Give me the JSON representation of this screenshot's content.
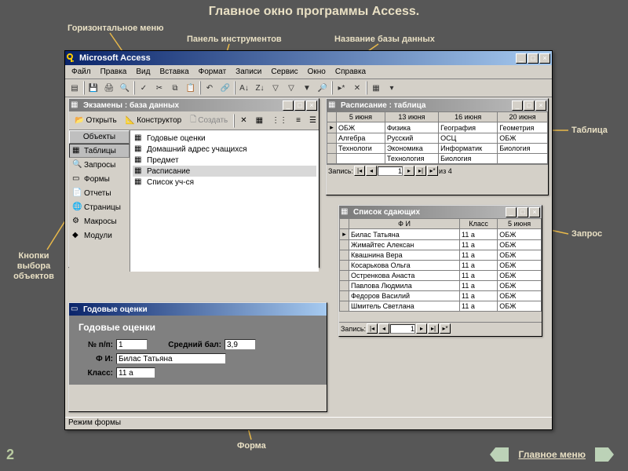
{
  "slide": {
    "title": "Главное окно программы Access.",
    "page_number": "2",
    "main_menu_link": "Главное меню"
  },
  "annotations": {
    "horiz_menu": "Горизонтальное меню",
    "toolbar": "Панель инструментов",
    "db_name": "Название базы данных",
    "table": "Таблица",
    "query": "Запрос",
    "form": "Форма",
    "obj_buttons": "Кнопки выбора объектов"
  },
  "app": {
    "title": "Microsoft Access",
    "menu": [
      "Файл",
      "Правка",
      "Вид",
      "Вставка",
      "Формат",
      "Записи",
      "Сервис",
      "Окно",
      "Справка"
    ],
    "status": "Режим формы"
  },
  "db_window": {
    "title": "Экзамены : база данных",
    "buttons": {
      "open": "Открыть",
      "design": "Конструктор",
      "create": "Создать"
    },
    "objects_header": "Объекты",
    "objects": [
      "Таблицы",
      "Запросы",
      "Формы",
      "Отчеты",
      "Страницы",
      "Макросы",
      "Модули"
    ],
    "list": [
      "Годовые оценки",
      "Домашний адрес учащихся",
      "Предмет",
      "Расписание",
      "Список уч-ся"
    ],
    "selected": "Расписание"
  },
  "table_window": {
    "title": "Расписание : таблица",
    "cols": [
      "5 июня",
      "13 июня",
      "16 июня",
      "20 июня"
    ],
    "rows": [
      [
        "ОБЖ",
        "Физика",
        "География",
        "Геометрия"
      ],
      [
        "Алгебра",
        "Русский",
        "ОСЦ",
        "ОБЖ"
      ],
      [
        "Технологи",
        "Экономика",
        "Информатик",
        "Биология"
      ],
      [
        "",
        "Технология",
        "Биология",
        ""
      ]
    ],
    "record_label": "Запись:",
    "record_value": "1",
    "record_total": "из 4"
  },
  "query_window": {
    "title": "Список сдающих",
    "cols": [
      "Ф И",
      "Класс",
      "5 июня"
    ],
    "rows": [
      [
        "Билас Татьяна",
        "11 а",
        "ОБЖ"
      ],
      [
        "Жимайтес Алексан",
        "11 а",
        "ОБЖ"
      ],
      [
        "Квашнина Вера",
        "11 а",
        "ОБЖ"
      ],
      [
        "Косарькова Ольга",
        "11 а",
        "ОБЖ"
      ],
      [
        "Остренкова Анаста",
        "11 а",
        "ОБЖ"
      ],
      [
        "Павлова Людмила",
        "11 а",
        "ОБЖ"
      ],
      [
        "Федоров Василий",
        "11 а",
        "ОБЖ"
      ],
      [
        "Шмитель Светлана",
        "11 а",
        "ОБЖ"
      ]
    ],
    "record_label": "Запись:",
    "record_value": "1"
  },
  "form_window": {
    "title": "Годовые оценки",
    "heading": "Годовые оценки",
    "fields": {
      "num_label": "№ п/п:",
      "num_value": "1",
      "avg_label": "Средний бал:",
      "avg_value": "3,9",
      "fio_label": "Ф И:",
      "fio_value": "Билас Татьяна",
      "class_label": "Класс:",
      "class_value": "11 а"
    }
  }
}
